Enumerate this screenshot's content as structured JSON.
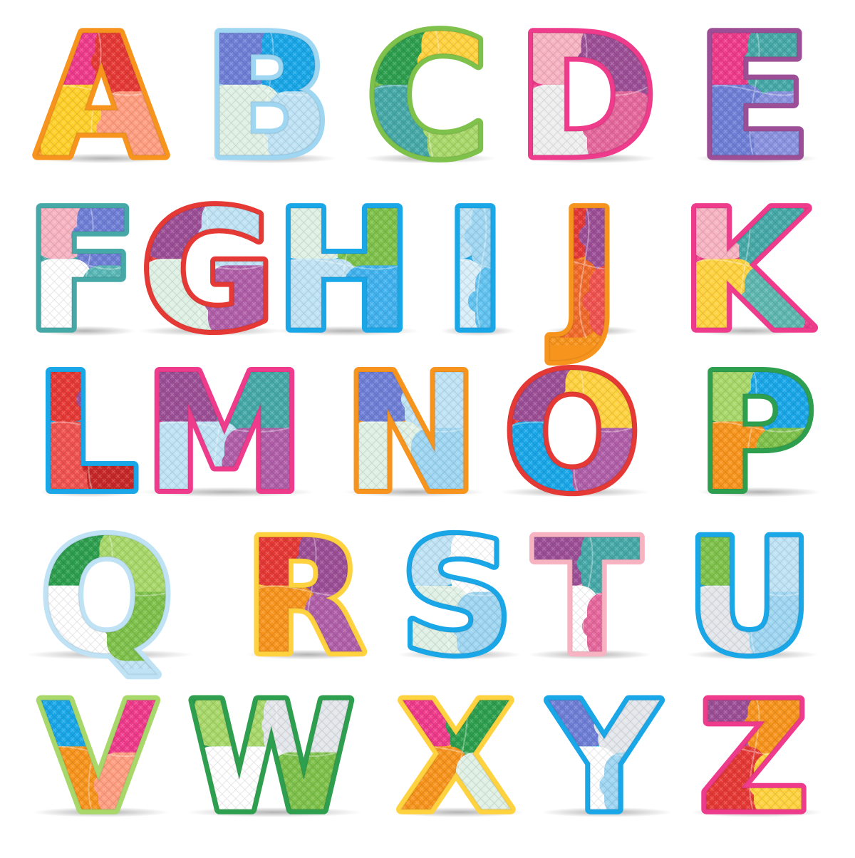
{
  "letters": [
    {
      "char": "A",
      "colors": [
        "#f7941d",
        "#ee3b8b",
        "#e53935",
        "#ffcf2a",
        "#ff9e80"
      ]
    },
    {
      "char": "B",
      "colors": [
        "#9fd6f2",
        "#6f7fd6",
        "#1aa7e8",
        "#dff0e4",
        "#bfe3f5"
      ]
    },
    {
      "char": "C",
      "colors": [
        "#7ec14b",
        "#2e9f4e",
        "#ffd23f",
        "#46a9a8",
        "#a8d86a"
      ]
    },
    {
      "char": "D",
      "colors": [
        "#ee3b8b",
        "#f7b3c2",
        "#9c4f96",
        "#eeeeee",
        "#e5689c"
      ]
    },
    {
      "char": "E",
      "colors": [
        "#9c4f96",
        "#ee3b8b",
        "#46a9a8",
        "#6f7fd6",
        "#8b93e0"
      ]
    },
    {
      "char": "F",
      "colors": [
        "#46a9a8",
        "#f7b3c2",
        "#6f7fd6",
        "#ffffff",
        "#5ab8b7"
      ]
    },
    {
      "char": "G",
      "colors": [
        "#e53935",
        "#9c4f96",
        "#bfe3f5",
        "#dff0e4",
        "#b05fa8"
      ]
    },
    {
      "char": "H",
      "colors": [
        "#1aa7e8",
        "#dff0e4",
        "#7ec14b",
        "#bfe3f5",
        "#42b2ee"
      ]
    },
    {
      "char": "I",
      "colors": [
        "#1aa7e8",
        "#bfe3f5",
        "#9fd6f2",
        "#d8eef9",
        "#62c3f0"
      ]
    },
    {
      "char": "J",
      "colors": [
        "#f7941d",
        "#e53935",
        "#9c4f96",
        "#f06a2a",
        "#ef5350"
      ]
    },
    {
      "char": "K",
      "colors": [
        "#ee3b8b",
        "#f7b3c2",
        "#46a9a8",
        "#ffd23f",
        "#5fb8b0"
      ]
    },
    {
      "char": "L",
      "colors": [
        "#1aa7e8",
        "#e53935",
        "#9c4f96",
        "#ef5350",
        "#c62828"
      ]
    },
    {
      "char": "M",
      "colors": [
        "#ee3b8b",
        "#9c4f96",
        "#46a9a8",
        "#bfe3f5",
        "#b05fa8"
      ]
    },
    {
      "char": "N",
      "colors": [
        "#f7941d",
        "#6f7fd6",
        "#bfe3f5",
        "#dff0e4",
        "#9fd6f2"
      ]
    },
    {
      "char": "O",
      "colors": [
        "#e53935",
        "#9c4f96",
        "#ffd23f",
        "#1aa7e8",
        "#b05fa8"
      ]
    },
    {
      "char": "P",
      "colors": [
        "#2e9f4e",
        "#a8d86a",
        "#1aa7e8",
        "#f7941d",
        "#7ec14b"
      ]
    },
    {
      "char": "Q",
      "colors": [
        "#bfe3f5",
        "#2e9f4e",
        "#a8d86a",
        "#ffffff",
        "#7ec14b"
      ]
    },
    {
      "char": "R",
      "colors": [
        "#ffd23f",
        "#e53935",
        "#9c4f96",
        "#f7941d",
        "#b05fa8"
      ]
    },
    {
      "char": "S",
      "colors": [
        "#1aa7e8",
        "#bfe3f5",
        "#ffffff",
        "#dff0e4",
        "#9fd6f2"
      ]
    },
    {
      "char": "T",
      "colors": [
        "#f7b3c2",
        "#9c4f96",
        "#46a9a8",
        "#ffffff",
        "#e5689c"
      ]
    },
    {
      "char": "U",
      "colors": [
        "#1aa7e8",
        "#7ec14b",
        "#bfe3f5",
        "#e3e6ea",
        "#9fd6f2"
      ]
    },
    {
      "char": "V",
      "colors": [
        "#a8d86a",
        "#1aa7e8",
        "#ee3b8b",
        "#f7941d",
        "#ff9e80"
      ]
    },
    {
      "char": "W",
      "colors": [
        "#2e9f4e",
        "#a8d86a",
        "#e3e6ea",
        "#ffffff",
        "#7ec14b"
      ]
    },
    {
      "char": "X",
      "colors": [
        "#ffd23f",
        "#ee3b8b",
        "#2e9f4e",
        "#f7941d",
        "#dff0e4"
      ]
    },
    {
      "char": "Y",
      "colors": [
        "#1aa7e8",
        "#6f7fd6",
        "#e3e6ea",
        "#ffffff",
        "#9fd6f2"
      ]
    },
    {
      "char": "Z",
      "colors": [
        "#ee3b8b",
        "#9c4f96",
        "#f7941d",
        "#e53935",
        "#ffd23f"
      ]
    }
  ]
}
